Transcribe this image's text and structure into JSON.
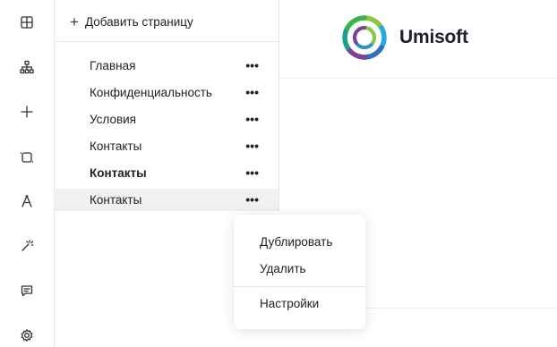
{
  "sidebar": {
    "icons": [
      "grid-icon",
      "sitemap-icon",
      "plus-icon",
      "frame-icon",
      "typography-icon",
      "magic-wand-icon",
      "comment-icon",
      "settings-icon"
    ]
  },
  "pages_panel": {
    "add_page_label": "Добавить страницу",
    "more_glyph": "•••",
    "pages": [
      {
        "label": "Главная",
        "bold": false,
        "active": false
      },
      {
        "label": "Конфиденциальность",
        "bold": false,
        "active": false
      },
      {
        "label": "Условия",
        "bold": false,
        "active": false
      },
      {
        "label": "Контакты",
        "bold": false,
        "active": false
      },
      {
        "label": "Контакты",
        "bold": true,
        "active": false
      },
      {
        "label": "Контакты",
        "bold": false,
        "active": true
      }
    ]
  },
  "canvas": {
    "brand_name": "Umisoft"
  },
  "context_menu": {
    "items": [
      "Дублировать",
      "Удалить",
      "Настройки"
    ]
  }
}
